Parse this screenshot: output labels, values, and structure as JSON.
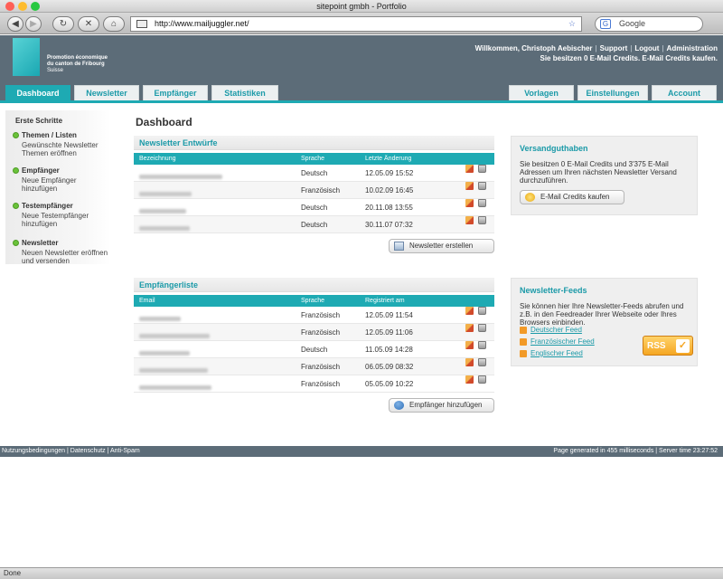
{
  "window": {
    "title": "sitepoint gmbh - Portfolio"
  },
  "browser": {
    "url": "http://www.mailjuggler.net/",
    "search_placeholder": "Google",
    "status": "Done"
  },
  "logo": {
    "line1": "Promotion économique",
    "line2": "du canton de Fribourg",
    "line3": "Suisse"
  },
  "header": {
    "user_links": [
      "Willkommen, Christoph Aebischer",
      "Support",
      "Logout",
      "Administration"
    ],
    "credits_text": "Sie besitzen 0 E-Mail Credits. E-Mail Credits kaufen."
  },
  "tabs_left": [
    "Dashboard",
    "Newsletter",
    "Empfänger",
    "Statistiken"
  ],
  "tabs_right": [
    "Vorlagen",
    "Einstellungen",
    "Account"
  ],
  "sidebar": {
    "title": "Erste Schritte",
    "steps": [
      {
        "title": "Themen / Listen",
        "desc": "Gewünschte Newsletter Themen eröffnen"
      },
      {
        "title": "Empfänger",
        "desc": "Neue Empfänger hinzufügen"
      },
      {
        "title": "Testempfänger",
        "desc": "Neue Testempfänger hinzufügen"
      },
      {
        "title": "Newsletter",
        "desc": "Neuen Newsletter eröffnen und versenden"
      }
    ]
  },
  "page_title": "Dashboard",
  "drafts": {
    "title": "Newsletter Entwürfe",
    "columns": [
      "Bezeichnung",
      "Sprache",
      "Letzte Änderung"
    ],
    "rows": [
      {
        "language": "Deutsch",
        "date": "12.05.09 15:52"
      },
      {
        "language": "Französisch",
        "date": "10.02.09 16:45"
      },
      {
        "language": "Deutsch",
        "date": "20.11.08 13:55"
      },
      {
        "language": "Deutsch",
        "date": "30.11.07 07:32"
      }
    ],
    "button": "Newsletter erstellen"
  },
  "recipients": {
    "title": "Empfängerliste",
    "columns": [
      "Email",
      "Sprache",
      "Registriert am"
    ],
    "rows": [
      {
        "language": "Französisch",
        "date": "12.05.09 11:54"
      },
      {
        "language": "Französisch",
        "date": "12.05.09 11:06"
      },
      {
        "language": "Deutsch",
        "date": "11.05.09 14:28"
      },
      {
        "language": "Französisch",
        "date": "06.05.09 08:32"
      },
      {
        "language": "Französisch",
        "date": "05.05.09 10:22"
      }
    ],
    "button": "Empfänger hinzufügen"
  },
  "credit_panel": {
    "title": "Versandguthaben",
    "text": "Sie besitzen 0 E-Mail Credits und 3'375 E-Mail Adressen um Ihren nächsten Newsletter Versand durchzuführen.",
    "button": "E-Mail Credits kaufen"
  },
  "feeds_panel": {
    "title": "Newsletter-Feeds",
    "text": "Sie können hier Ihre Newsletter-Feeds abrufen und z.B. in den Feedreader Ihrer Webseite oder Ihres Browsers einbinden.",
    "links": [
      "Deutscher Feed",
      "Französischer Feed",
      "Englischer Feed"
    ],
    "badge": "RSS"
  },
  "footer": {
    "left": "Nutzungsbedingungen | Datenschutz | Anti-Spam",
    "right": "Page generated in 455 milliseconds | Server time 23:27:52"
  },
  "colors": {
    "accent": "#1eaab3",
    "header": "#5c6c78"
  }
}
